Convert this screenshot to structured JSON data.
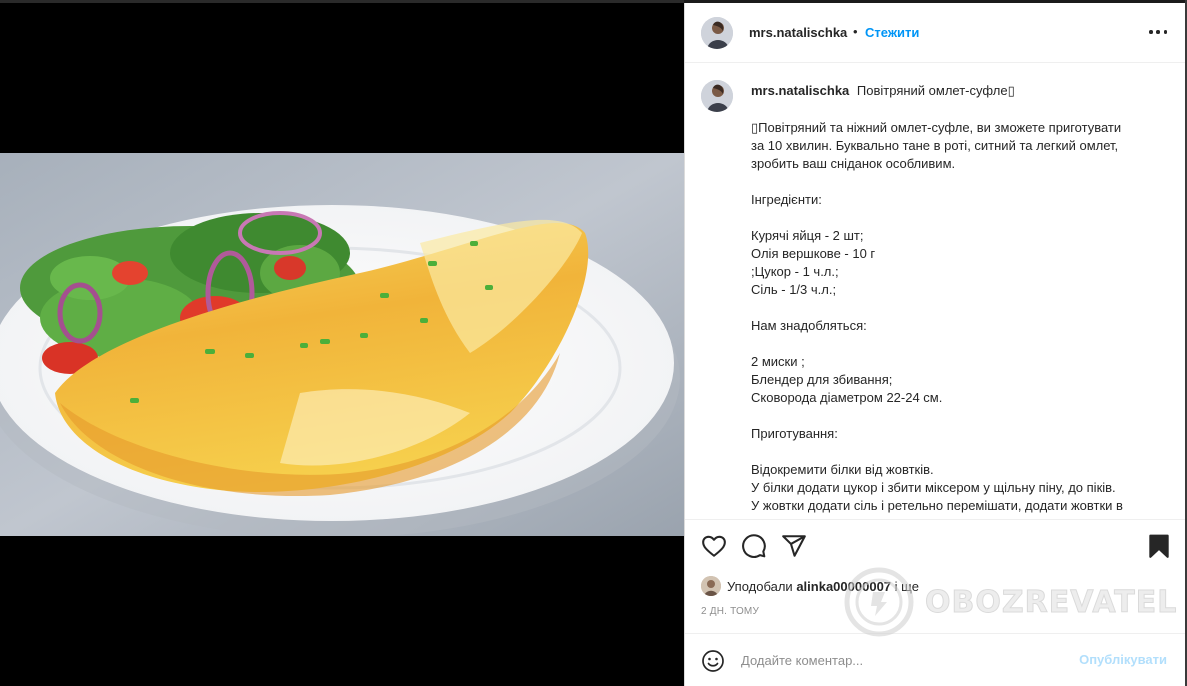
{
  "post": {
    "username": "mrs.natalischka",
    "separator": "•",
    "follow_label": "Стежити",
    "more_icon": "more-horizontal-icon"
  },
  "caption": {
    "username": "mrs.natalischka",
    "title": "Повітряний омлет-суфле▯",
    "lines": [
      "▯Повітряний та ніжний омлет-суфле, ви зможете приготувати",
      "за 10 хвилин. Буквально тане в роті, ситний та легкий омлет,",
      "зробить ваш сніданок особливим.",
      "",
      "Інгредієнти:",
      "",
      "Курячі яйця - 2 шт;",
      "Олія вершкове - 10 г",
      ";Цукор - 1 ч.л.;",
      "Сіль - 1/3 ч.л.;",
      "",
      "Нам знадобляться:",
      "",
      "2 миски ;",
      "Блендер для збивання;",
      "Сковорода діаметром 22-24 см.",
      "",
      "Приготування:",
      "",
      "Відокремити білки від жовтків.",
      "У білки додати цукор і збити міксером у щільну піну, до піків.",
      "У жовтки додати сіль і ретельно перемішати, додати жовтки в"
    ]
  },
  "actions": {
    "like_icon": "heart-icon",
    "comment_icon": "comment-icon",
    "share_icon": "send-icon",
    "save_icon": "bookmark-icon"
  },
  "likes": {
    "prefix": "Уподобали",
    "user": "alinka00000007",
    "suffix": "і ще"
  },
  "time_ago": "2 ДН. ТОМУ",
  "comment": {
    "placeholder": "Додайте коментар...",
    "publish_label": "Опублікувати",
    "emoji_icon": "emoji-icon"
  },
  "watermark": {
    "text": "OBOZREVATEL"
  },
  "colors": {
    "accent": "#0095f6",
    "publish_disabled": "#b2dffc",
    "muted": "#8e8e8e"
  }
}
